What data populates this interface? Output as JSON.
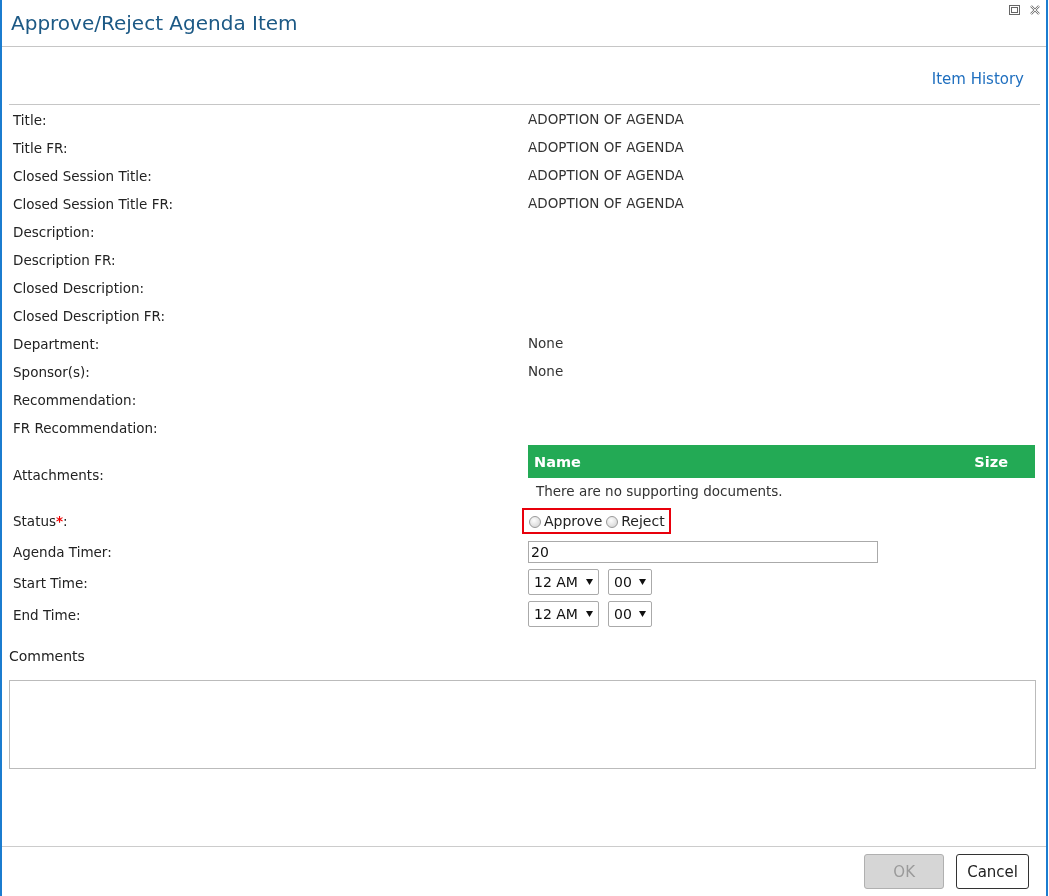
{
  "window": {
    "title": "Approve/Reject Agenda Item"
  },
  "header_link": {
    "label": "Item History"
  },
  "fields": [
    {
      "kind": "text",
      "label": "Title:",
      "value": "ADOPTION OF AGENDA"
    },
    {
      "kind": "text",
      "label": "Title FR:",
      "value": "ADOPTION OF AGENDA"
    },
    {
      "kind": "text",
      "label": "Closed Session Title:",
      "value": "ADOPTION OF AGENDA"
    },
    {
      "kind": "text",
      "label": "Closed Session Title FR:",
      "value": "ADOPTION OF AGENDA"
    },
    {
      "kind": "text",
      "label": "Description:"
    },
    {
      "kind": "text",
      "label": "Description FR:"
    },
    {
      "kind": "text",
      "label": "Closed Description:"
    },
    {
      "kind": "text",
      "label": "Closed Description FR:"
    },
    {
      "kind": "text",
      "label": "Department:",
      "value": "None"
    },
    {
      "kind": "text",
      "label": "Sponsor(s):",
      "value": "None"
    },
    {
      "kind": "text",
      "label": "Recommendation:"
    },
    {
      "kind": "text",
      "label": "FR Recommendation:"
    },
    {
      "kind": "attachments",
      "label": "Attachments:",
      "columns": [
        "Name",
        "Size"
      ],
      "empty_text": "There are no supporting documents."
    },
    {
      "kind": "radio",
      "label": "Status",
      "required_mark": "*",
      "label_end": ":",
      "highlighted": true,
      "options": [
        {
          "label": "Approve",
          "selected": false
        },
        {
          "label": "Reject",
          "selected": false
        }
      ]
    },
    {
      "kind": "input",
      "label": "Agenda Timer:",
      "value": "20"
    },
    {
      "kind": "time",
      "label": "Start Time:",
      "hour": "12 AM",
      "minute": "00"
    },
    {
      "kind": "time",
      "label": "End Time:",
      "hour": "12 AM",
      "minute": "00"
    }
  ],
  "comments": {
    "label": "Comments"
  },
  "buttons": [
    {
      "label": "OK",
      "disabled": true
    },
    {
      "label": "Cancel",
      "disabled": false
    }
  ]
}
